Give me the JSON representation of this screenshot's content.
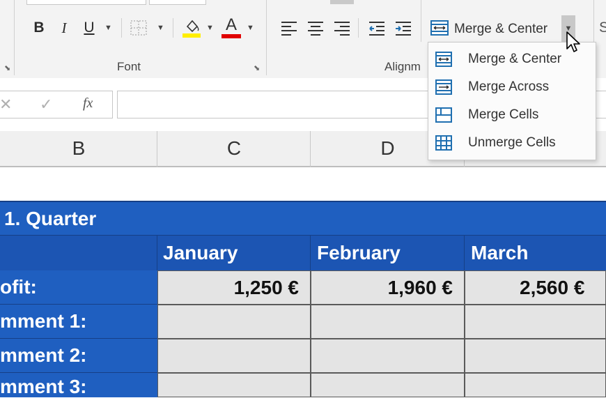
{
  "ribbon": {
    "font_group_label": "Font",
    "alignment_group_label": "Alignm",
    "bold": "B",
    "italic": "I",
    "underline": "U",
    "font_color_letter": "A",
    "merge_button_label": "Merge & Center",
    "partial_letter": "S"
  },
  "formula_bar": {
    "cancel_symbol": "✕",
    "enter_symbol": "✓",
    "fx_label": "fx",
    "content": ""
  },
  "columns": [
    "B",
    "C",
    "D"
  ],
  "merge_menu": {
    "items": [
      "Merge & Center",
      "Merge Across",
      "Merge Cells",
      "Unmerge Cells"
    ]
  },
  "sheet": {
    "title": "1. Quarter",
    "months": [
      "January",
      "February",
      "March"
    ],
    "rows": [
      {
        "label": "ofit:",
        "values": [
          "1,250 €",
          "1,960 €",
          "2,560 €"
        ]
      },
      {
        "label": "mment 1:",
        "values": [
          "",
          "",
          ""
        ]
      },
      {
        "label": "mment 2:",
        "values": [
          "",
          "",
          ""
        ]
      },
      {
        "label": "mment 3:",
        "values": [
          "",
          "",
          ""
        ]
      }
    ]
  },
  "colors": {
    "header_blue": "#1f5fc0",
    "value_grey": "#e4e4e4",
    "font_color_red": "#e00000",
    "highlight_yellow": "#ffee00",
    "icon_blue": "#1f6fb0"
  }
}
